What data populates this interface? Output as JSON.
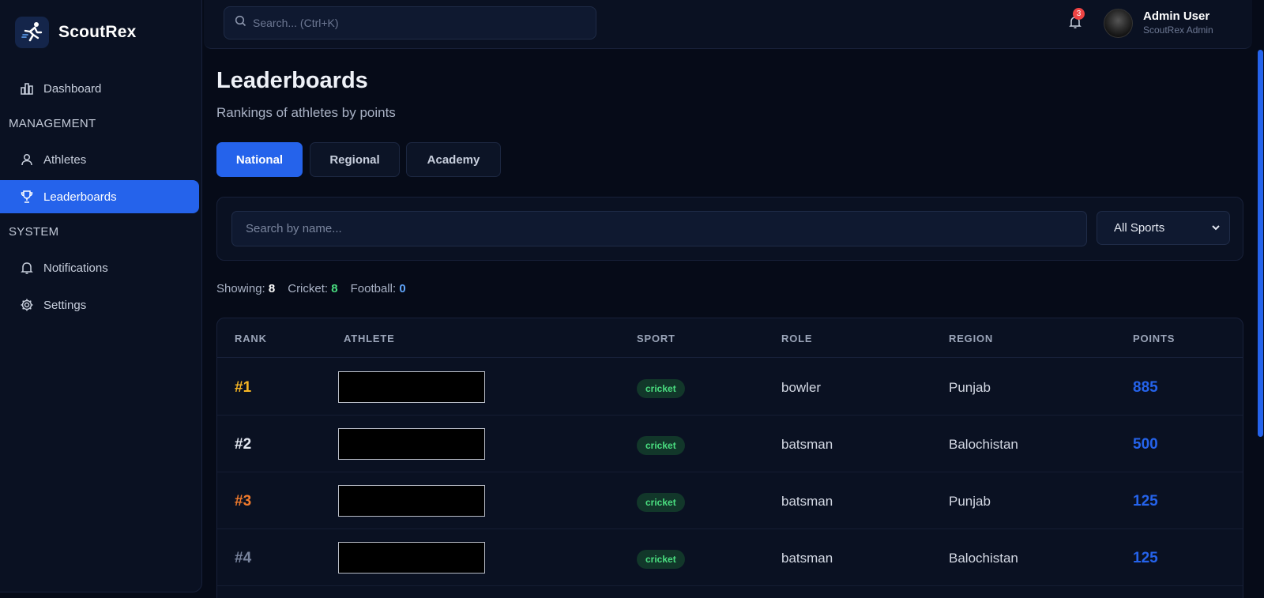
{
  "brand": {
    "name": "ScoutRex",
    "accent": "#2563eb"
  },
  "sidebar": {
    "items": [
      {
        "label": "Dashboard",
        "icon": "bar-chart-icon"
      },
      {
        "label": "Athletes",
        "icon": "user-icon"
      },
      {
        "label": "Leaderboards",
        "icon": "trophy-icon",
        "active": true
      },
      {
        "label": "Notifications",
        "icon": "bell-icon"
      },
      {
        "label": "Settings",
        "icon": "gear-icon"
      }
    ],
    "sections": {
      "management": "MANAGEMENT",
      "system": "SYSTEM"
    }
  },
  "topbar": {
    "search_placeholder": "Search... (Ctrl+K)",
    "notification_count": "3",
    "user_name": "Admin User",
    "user_role": "ScoutRex Admin"
  },
  "page": {
    "title": "Leaderboards",
    "subtitle": "Rankings of athletes by points"
  },
  "tabs": [
    {
      "label": "National",
      "active": true
    },
    {
      "label": "Regional"
    },
    {
      "label": "Academy"
    }
  ],
  "filters": {
    "name_placeholder": "Search by name...",
    "sport_selected": "All Sports"
  },
  "stats": {
    "showing_label": "Showing:",
    "showing": "8",
    "cricket_label": "Cricket:",
    "cricket": "8",
    "football_label": "Football:",
    "football": "0"
  },
  "table": {
    "headers": [
      "RANK",
      "ATHLETE",
      "SPORT",
      "ROLE",
      "REGION",
      "POINTS"
    ],
    "rows": [
      {
        "rank": "#1",
        "rank_color": "#f5b524",
        "sport": "cricket",
        "role": "bowler",
        "region": "Punjab",
        "points": "885"
      },
      {
        "rank": "#2",
        "rank_color": "#e5e9f2",
        "sport": "cricket",
        "role": "batsman",
        "region": "Balochistan",
        "points": "500"
      },
      {
        "rank": "#3",
        "rank_color": "#f07a2c",
        "sport": "cricket",
        "role": "batsman",
        "region": "Punjab",
        "points": "125"
      },
      {
        "rank": "#4",
        "rank_color": "#7a859e",
        "sport": "cricket",
        "role": "batsman",
        "region": "Balochistan",
        "points": "125"
      }
    ]
  }
}
